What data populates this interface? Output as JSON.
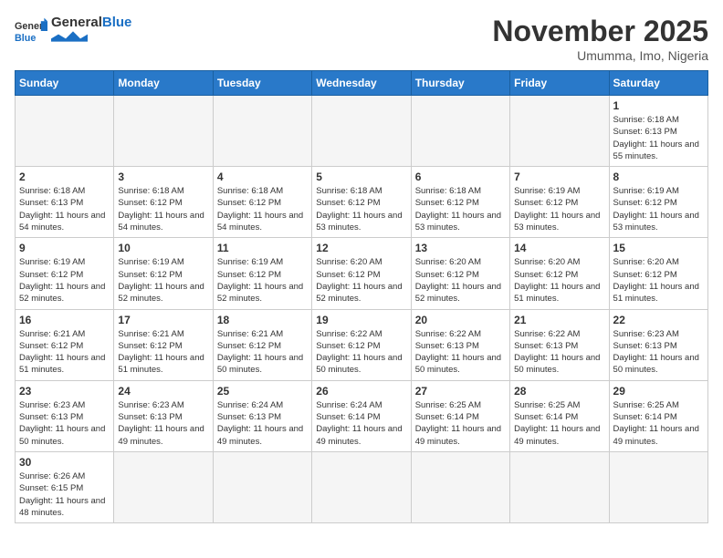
{
  "header": {
    "logo_general": "General",
    "logo_blue": "Blue",
    "title": "November 2025",
    "subtitle": "Umumma, Imo, Nigeria"
  },
  "weekdays": [
    "Sunday",
    "Monday",
    "Tuesday",
    "Wednesday",
    "Thursday",
    "Friday",
    "Saturday"
  ],
  "days": [
    {
      "date": 1,
      "sunrise": "6:18 AM",
      "sunset": "6:13 PM",
      "daylight": "11 hours and 55 minutes."
    },
    {
      "date": 2,
      "sunrise": "6:18 AM",
      "sunset": "6:13 PM",
      "daylight": "11 hours and 54 minutes."
    },
    {
      "date": 3,
      "sunrise": "6:18 AM",
      "sunset": "6:12 PM",
      "daylight": "11 hours and 54 minutes."
    },
    {
      "date": 4,
      "sunrise": "6:18 AM",
      "sunset": "6:12 PM",
      "daylight": "11 hours and 54 minutes."
    },
    {
      "date": 5,
      "sunrise": "6:18 AM",
      "sunset": "6:12 PM",
      "daylight": "11 hours and 53 minutes."
    },
    {
      "date": 6,
      "sunrise": "6:18 AM",
      "sunset": "6:12 PM",
      "daylight": "11 hours and 53 minutes."
    },
    {
      "date": 7,
      "sunrise": "6:19 AM",
      "sunset": "6:12 PM",
      "daylight": "11 hours and 53 minutes."
    },
    {
      "date": 8,
      "sunrise": "6:19 AM",
      "sunset": "6:12 PM",
      "daylight": "11 hours and 53 minutes."
    },
    {
      "date": 9,
      "sunrise": "6:19 AM",
      "sunset": "6:12 PM",
      "daylight": "11 hours and 52 minutes."
    },
    {
      "date": 10,
      "sunrise": "6:19 AM",
      "sunset": "6:12 PM",
      "daylight": "11 hours and 52 minutes."
    },
    {
      "date": 11,
      "sunrise": "6:19 AM",
      "sunset": "6:12 PM",
      "daylight": "11 hours and 52 minutes."
    },
    {
      "date": 12,
      "sunrise": "6:20 AM",
      "sunset": "6:12 PM",
      "daylight": "11 hours and 52 minutes."
    },
    {
      "date": 13,
      "sunrise": "6:20 AM",
      "sunset": "6:12 PM",
      "daylight": "11 hours and 52 minutes."
    },
    {
      "date": 14,
      "sunrise": "6:20 AM",
      "sunset": "6:12 PM",
      "daylight": "11 hours and 51 minutes."
    },
    {
      "date": 15,
      "sunrise": "6:20 AM",
      "sunset": "6:12 PM",
      "daylight": "11 hours and 51 minutes."
    },
    {
      "date": 16,
      "sunrise": "6:21 AM",
      "sunset": "6:12 PM",
      "daylight": "11 hours and 51 minutes."
    },
    {
      "date": 17,
      "sunrise": "6:21 AM",
      "sunset": "6:12 PM",
      "daylight": "11 hours and 51 minutes."
    },
    {
      "date": 18,
      "sunrise": "6:21 AM",
      "sunset": "6:12 PM",
      "daylight": "11 hours and 50 minutes."
    },
    {
      "date": 19,
      "sunrise": "6:22 AM",
      "sunset": "6:12 PM",
      "daylight": "11 hours and 50 minutes."
    },
    {
      "date": 20,
      "sunrise": "6:22 AM",
      "sunset": "6:13 PM",
      "daylight": "11 hours and 50 minutes."
    },
    {
      "date": 21,
      "sunrise": "6:22 AM",
      "sunset": "6:13 PM",
      "daylight": "11 hours and 50 minutes."
    },
    {
      "date": 22,
      "sunrise": "6:23 AM",
      "sunset": "6:13 PM",
      "daylight": "11 hours and 50 minutes."
    },
    {
      "date": 23,
      "sunrise": "6:23 AM",
      "sunset": "6:13 PM",
      "daylight": "11 hours and 50 minutes."
    },
    {
      "date": 24,
      "sunrise": "6:23 AM",
      "sunset": "6:13 PM",
      "daylight": "11 hours and 49 minutes."
    },
    {
      "date": 25,
      "sunrise": "6:24 AM",
      "sunset": "6:13 PM",
      "daylight": "11 hours and 49 minutes."
    },
    {
      "date": 26,
      "sunrise": "6:24 AM",
      "sunset": "6:14 PM",
      "daylight": "11 hours and 49 minutes."
    },
    {
      "date": 27,
      "sunrise": "6:25 AM",
      "sunset": "6:14 PM",
      "daylight": "11 hours and 49 minutes."
    },
    {
      "date": 28,
      "sunrise": "6:25 AM",
      "sunset": "6:14 PM",
      "daylight": "11 hours and 49 minutes."
    },
    {
      "date": 29,
      "sunrise": "6:25 AM",
      "sunset": "6:14 PM",
      "daylight": "11 hours and 49 minutes."
    },
    {
      "date": 30,
      "sunrise": "6:26 AM",
      "sunset": "6:15 PM",
      "daylight": "11 hours and 48 minutes."
    }
  ],
  "labels": {
    "sunrise": "Sunrise:",
    "sunset": "Sunset:",
    "daylight": "Daylight hours"
  }
}
